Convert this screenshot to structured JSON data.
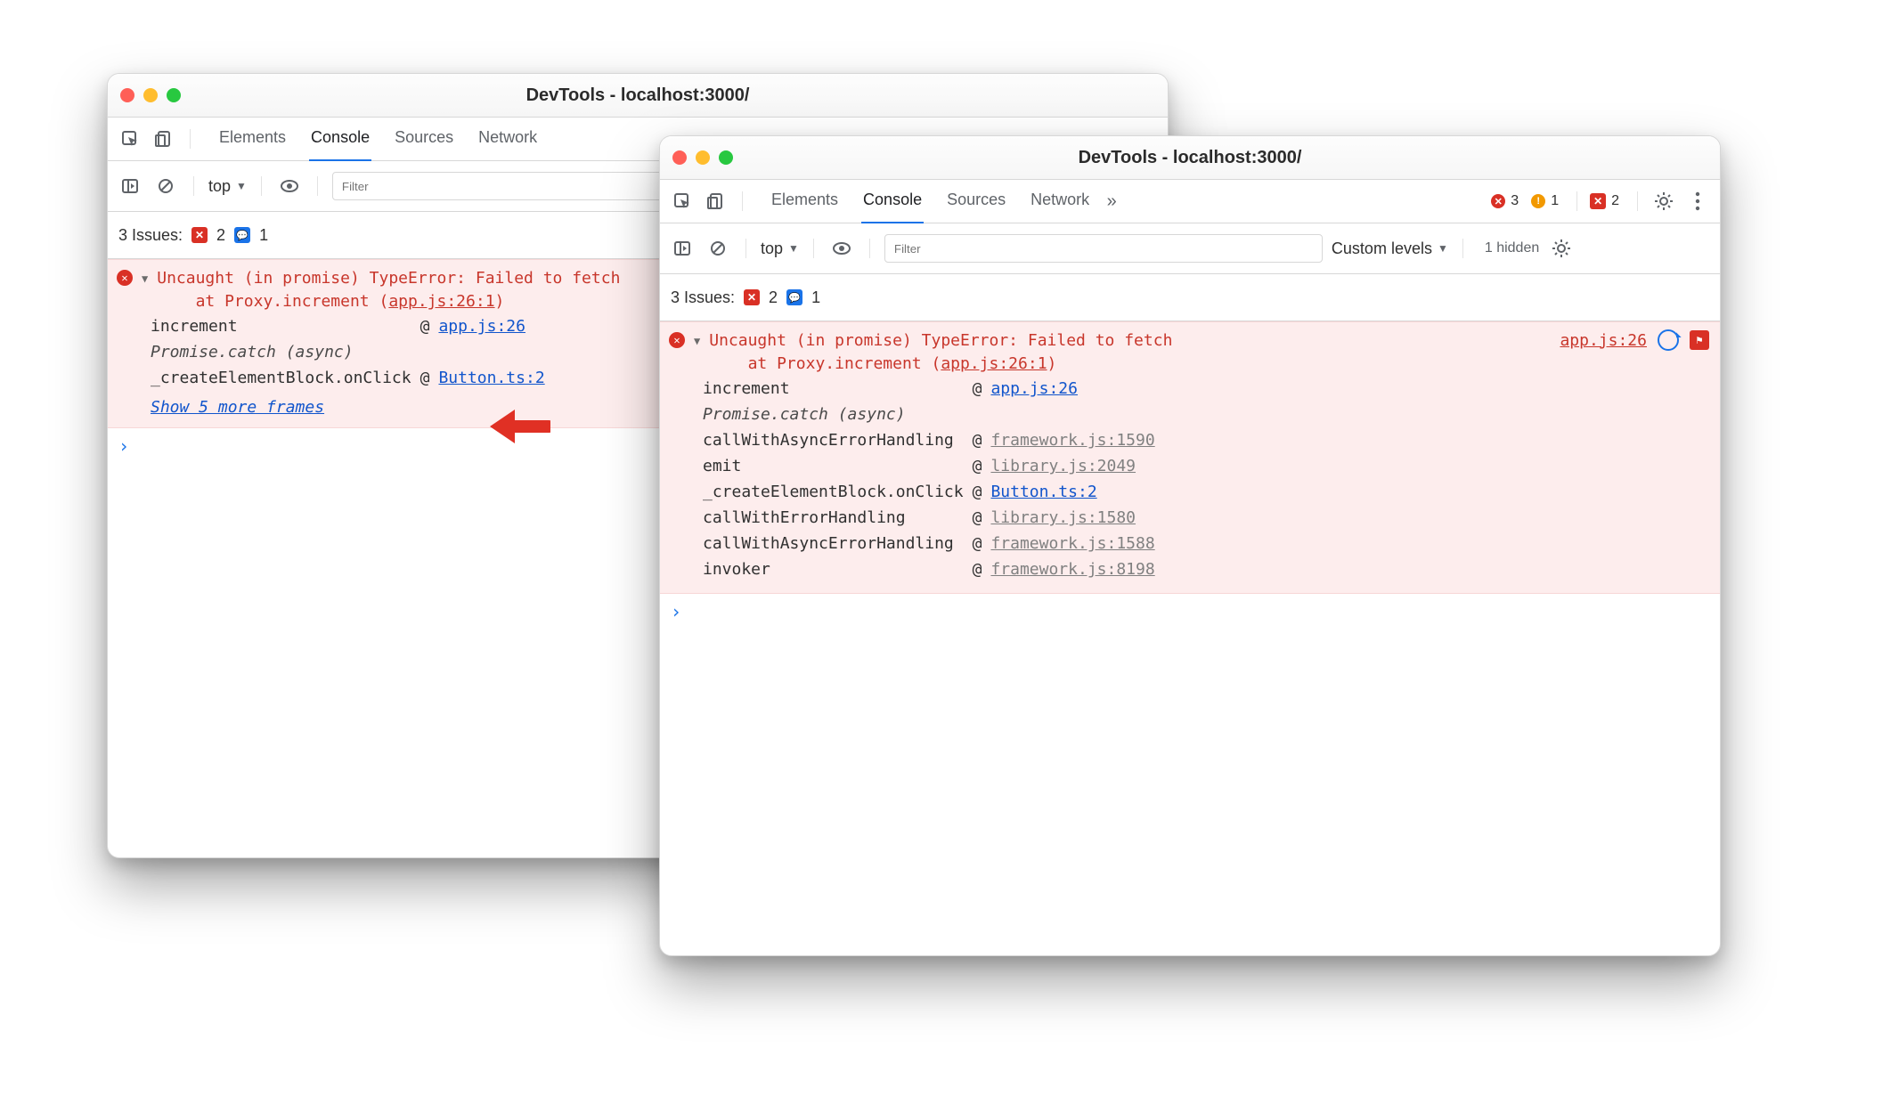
{
  "window": {
    "title": "DevTools - localhost:3000/"
  },
  "tabs": {
    "elements": "Elements",
    "console": "Console",
    "sources": "Sources",
    "network": "Network"
  },
  "toolbar": {
    "context": "top",
    "filter_placeholder": "Filter",
    "levels": "Custom levels",
    "hidden": "1 hidden"
  },
  "counts": {
    "errors": "3",
    "warnings": "1",
    "messages": "2"
  },
  "issues": {
    "label": "3 Issues:",
    "errors": "2",
    "info": "1"
  },
  "glyphs": {
    "x": "✕",
    "exc": "!",
    "chat": "▤",
    "flag": "⚑",
    "caret": "▼",
    "chevr": "»",
    "eye": "◉",
    "play": "⏵",
    "stop": "⦸",
    "prompt": "›"
  },
  "error": {
    "line1": "Uncaught (in promise) TypeError: Failed to fetch",
    "line2a": "    at Proxy.increment (",
    "line2loc": "app.js:26:1",
    "line2b": ")",
    "src_link": "app.js:26",
    "at": "@"
  },
  "stack_left": [
    {
      "fn": "increment",
      "link": "app.js:26",
      "cls": "blue",
      "async": false
    },
    {
      "fn": "Promise.catch (async)",
      "link": "",
      "cls": "",
      "async": true
    },
    {
      "fn": "_createElementBlock.onClick",
      "link": "Button.ts:2",
      "cls": "blue",
      "async": false
    }
  ],
  "show_more": "Show 5 more frames",
  "stack_right": [
    {
      "fn": "increment",
      "link": "app.js:26",
      "cls": "blue",
      "async": false
    },
    {
      "fn": "Promise.catch (async)",
      "link": "",
      "cls": "",
      "async": true
    },
    {
      "fn": "callWithAsyncErrorHandling",
      "link": "framework.js:1590",
      "cls": "grey",
      "async": false
    },
    {
      "fn": "emit",
      "link": "library.js:2049",
      "cls": "grey",
      "async": false
    },
    {
      "fn": "_createElementBlock.onClick",
      "link": "Button.ts:2",
      "cls": "blue",
      "async": false
    },
    {
      "fn": "callWithErrorHandling",
      "link": "library.js:1580",
      "cls": "grey",
      "async": false
    },
    {
      "fn": "callWithAsyncErrorHandling",
      "link": "framework.js:1588",
      "cls": "grey",
      "async": false
    },
    {
      "fn": "invoker",
      "link": "framework.js:8198",
      "cls": "grey",
      "async": false
    }
  ]
}
